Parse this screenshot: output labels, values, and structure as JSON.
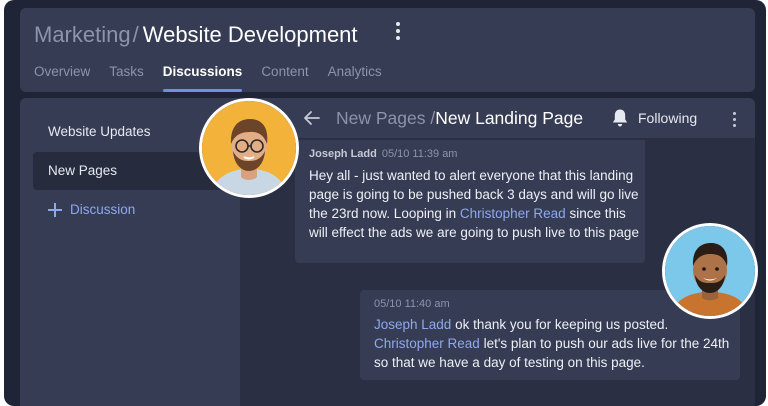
{
  "header": {
    "breadcrumb_parent": "Marketing",
    "breadcrumb_separator": "/",
    "breadcrumb_current": "Website Development"
  },
  "tabs": [
    {
      "label": "Overview"
    },
    {
      "label": "Tasks"
    },
    {
      "label": "Discussions"
    },
    {
      "label": "Content"
    },
    {
      "label": "Analytics"
    }
  ],
  "active_tab": "Discussions",
  "sidebar": {
    "items": [
      {
        "label": "Website Updates"
      },
      {
        "label": "New Pages"
      }
    ],
    "add_label": "Discussion"
  },
  "thread": {
    "title_parent": "New Pages /",
    "title_current": "New Landing Page",
    "following_label": "Following"
  },
  "messages": [
    {
      "author": "Joseph Ladd",
      "timestamp": "05/10 11:39 am",
      "text_before": "Hey all - just wanted to alert everyone that this landing page is going to be pushed back 3 days and will go live the 23rd now. Looping in ",
      "mention": "Christopher Read",
      "text_after": " since this will effect the ads we are going to push live to this page"
    },
    {
      "timestamp": "05/10 11:40 am",
      "mention1": "Joseph Ladd",
      "text1": " ok thank you for keeping us posted.",
      "mention2": "Christopher Read",
      "text2": " let's plan to push our ads live for the 24th so that we have a day of testing on this page."
    }
  ],
  "colors": {
    "background": "#1f2436",
    "panel": "#363c53",
    "accent": "#6f8ee6",
    "mention": "#8ea8ee",
    "avatar1_bg": "#f3b23a",
    "avatar2_bg": "#7cc8ea"
  },
  "icons": {
    "header_menu": "kebab-vertical-icon",
    "add": "plus-icon",
    "back": "arrow-left-icon",
    "bell": "bell-icon",
    "thread_menu": "kebab-vertical-icon"
  }
}
